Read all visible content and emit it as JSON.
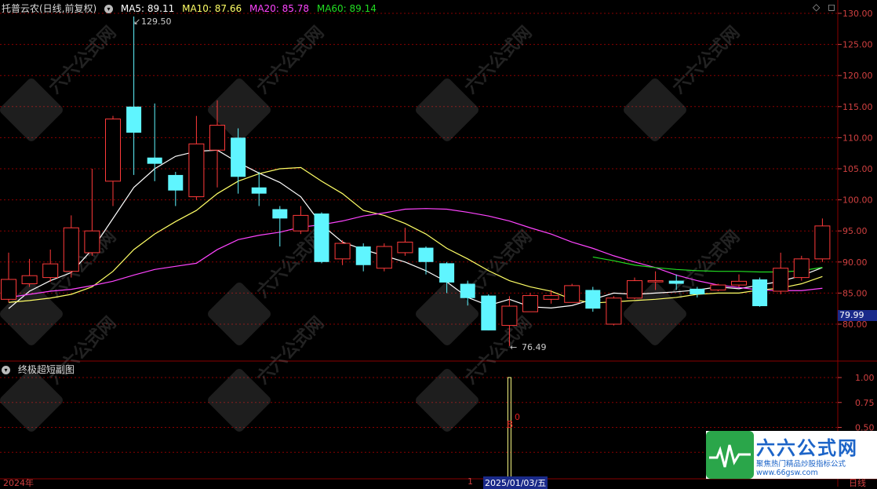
{
  "header": {
    "stock_title": "托普云农(日线,前复权)",
    "ma5_label": "MA5: 89.11",
    "ma10_label": "MA10: 87.66",
    "ma20_label": "MA20: 85.78",
    "ma60_label": "MA60: 89.14"
  },
  "colors": {
    "up": "#ff3a3a",
    "down": "#5ff5ff",
    "ma5": "#ffffff",
    "ma10": "#ffff66",
    "ma20": "#ff44ff",
    "ma60": "#22dd22",
    "grid": "#8a0000",
    "axis": "#d04040"
  },
  "sub_panel": {
    "title": "终极超短副图",
    "signal_text": "0",
    "signal_letter": "B"
  },
  "price_tag": "79.99",
  "annotations": {
    "high": "129.50",
    "low": "76.49"
  },
  "bottom_bar": {
    "year_label": "2024年",
    "marker": "1",
    "date_label": "2025/01/03/五",
    "period_label": "日线"
  },
  "watermark": {
    "brand": "六六公式网",
    "slogan": "聚焦热门精品炒股指标公式",
    "url": "www.66gsw.com"
  },
  "chart_data": {
    "type": "candlestick",
    "y_ticks": [
      "130.00",
      "125.00",
      "120.00",
      "115.00",
      "110.00",
      "105.00",
      "100.00",
      "95.00",
      "90.00",
      "85.00",
      "80.00"
    ],
    "sub_y_ticks": [
      "1.00",
      "0.75",
      "0.50",
      "0.25"
    ],
    "ylim": [
      77,
      131
    ],
    "candles": [
      {
        "o": 84.0,
        "c": 87.2,
        "h": 91.5,
        "l": 83.5
      },
      {
        "o": 86.5,
        "c": 87.8,
        "h": 90.5,
        "l": 86.0
      },
      {
        "o": 87.5,
        "c": 89.7,
        "h": 92.0,
        "l": 86.8
      },
      {
        "o": 88.5,
        "c": 95.5,
        "h": 97.5,
        "l": 87.5
      },
      {
        "o": 91.5,
        "c": 95.0,
        "h": 105.0,
        "l": 91.0
      },
      {
        "o": 103.0,
        "c": 113.0,
        "h": 113.5,
        "l": 99.0
      },
      {
        "o": 115.0,
        "c": 110.8,
        "h": 129.5,
        "l": 104.0
      },
      {
        "o": 106.8,
        "c": 105.8,
        "h": 115.5,
        "l": 103.0
      },
      {
        "o": 104.0,
        "c": 101.5,
        "h": 104.5,
        "l": 99.0
      },
      {
        "o": 100.5,
        "c": 109.0,
        "h": 113.5,
        "l": 100.0
      },
      {
        "o": 108.0,
        "c": 112.0,
        "h": 116.0,
        "l": 102.0
      },
      {
        "o": 110.0,
        "c": 103.7,
        "h": 111.5,
        "l": 101.0
      },
      {
        "o": 102.0,
        "c": 101.0,
        "h": 104.5,
        "l": 99.0
      },
      {
        "o": 98.5,
        "c": 97.0,
        "h": 99.0,
        "l": 92.5
      },
      {
        "o": 95.0,
        "c": 97.5,
        "h": 99.0,
        "l": 94.5
      },
      {
        "o": 97.8,
        "c": 90.0,
        "h": 98.0,
        "l": 89.8
      },
      {
        "o": 90.5,
        "c": 93.0,
        "h": 93.5,
        "l": 89.5
      },
      {
        "o": 92.5,
        "c": 89.5,
        "h": 93.0,
        "l": 88.5
      },
      {
        "o": 89.0,
        "c": 92.5,
        "h": 93.0,
        "l": 88.5
      },
      {
        "o": 91.5,
        "c": 93.2,
        "h": 95.5,
        "l": 91.0
      },
      {
        "o": 92.3,
        "c": 90.0,
        "h": 92.5,
        "l": 88.0
      },
      {
        "o": 89.8,
        "c": 86.7,
        "h": 90.0,
        "l": 85.0
      },
      {
        "o": 86.5,
        "c": 84.2,
        "h": 87.0,
        "l": 83.0
      },
      {
        "o": 84.6,
        "c": 79.0,
        "h": 84.8,
        "l": 79.0
      },
      {
        "o": 79.8,
        "c": 82.9,
        "h": 84.5,
        "l": 76.5
      },
      {
        "o": 82.0,
        "c": 84.6,
        "h": 85.0,
        "l": 82.0
      },
      {
        "o": 84.0,
        "c": 84.6,
        "h": 85.5,
        "l": 83.3
      },
      {
        "o": 83.5,
        "c": 86.2,
        "h": 86.5,
        "l": 83.5
      },
      {
        "o": 85.5,
        "c": 82.5,
        "h": 86.0,
        "l": 82.0
      },
      {
        "o": 80.0,
        "c": 84.2,
        "h": 84.5,
        "l": 79.8
      },
      {
        "o": 84.2,
        "c": 87.0,
        "h": 87.5,
        "l": 84.0
      },
      {
        "o": 86.8,
        "c": 87.0,
        "h": 88.5,
        "l": 85.5
      },
      {
        "o": 87.0,
        "c": 86.5,
        "h": 88.0,
        "l": 85.5
      },
      {
        "o": 85.7,
        "c": 84.8,
        "h": 86.0,
        "l": 84.3
      },
      {
        "o": 85.5,
        "c": 86.3,
        "h": 86.5,
        "l": 85.3
      },
      {
        "o": 86.3,
        "c": 86.9,
        "h": 88.0,
        "l": 86.0
      },
      {
        "o": 87.2,
        "c": 82.9,
        "h": 87.5,
        "l": 82.8
      },
      {
        "o": 85.3,
        "c": 89.0,
        "h": 91.5,
        "l": 84.8
      },
      {
        "o": 87.5,
        "c": 90.5,
        "h": 91.0,
        "l": 87.0
      },
      {
        "o": 90.5,
        "c": 95.8,
        "h": 97.0,
        "l": 90.0
      }
    ],
    "ma5": [
      82.5,
      85.3,
      87.0,
      88.3,
      92.0,
      97.0,
      102.0,
      105.0,
      107.0,
      107.8,
      108.0,
      106.0,
      104.3,
      102.8,
      100.5,
      96.0,
      93.2,
      92.0,
      91.0,
      90.0,
      88.6,
      86.8,
      84.3,
      83.0,
      84.0,
      82.8,
      82.6,
      83.0,
      84.0,
      85.0,
      84.8,
      85.0,
      85.2,
      85.5,
      86.0,
      85.7,
      86.3,
      86.9,
      87.8,
      89.1
    ],
    "ma10": [
      83.5,
      83.8,
      84.2,
      84.8,
      86.0,
      88.5,
      92.0,
      94.5,
      96.5,
      98.3,
      101.0,
      103.0,
      104.2,
      105.0,
      105.2,
      103.0,
      101.0,
      98.3,
      97.5,
      96.2,
      94.5,
      92.2,
      90.5,
      88.6,
      87.0,
      86.0,
      85.3,
      84.0,
      83.4,
      83.6,
      83.8,
      84.0,
      84.3,
      84.8,
      85.0,
      85.0,
      85.5,
      85.8,
      86.5,
      87.66
    ],
    "ma20": [
      84.3,
      84.8,
      85.3,
      85.6,
      86.2,
      86.9,
      87.9,
      88.8,
      89.3,
      89.8,
      92.0,
      93.6,
      94.3,
      94.8,
      95.6,
      96.0,
      96.6,
      97.4,
      97.9,
      98.5,
      98.6,
      98.5,
      98.0,
      97.4,
      96.6,
      95.5,
      94.5,
      93.2,
      92.2,
      91.0,
      90.0,
      89.1,
      87.9,
      87.0,
      86.3,
      85.9,
      85.5,
      85.4,
      85.4,
      85.78
    ],
    "ma60": [
      null,
      null,
      null,
      null,
      null,
      null,
      null,
      null,
      null,
      null,
      null,
      null,
      null,
      null,
      null,
      null,
      null,
      null,
      null,
      null,
      null,
      null,
      null,
      null,
      null,
      null,
      null,
      null,
      90.8,
      90.2,
      89.5,
      89.1,
      88.8,
      88.6,
      88.5,
      88.5,
      88.4,
      88.4,
      88.6,
      89.14
    ],
    "sub_signal": {
      "index": 24,
      "value": 1.0
    }
  }
}
